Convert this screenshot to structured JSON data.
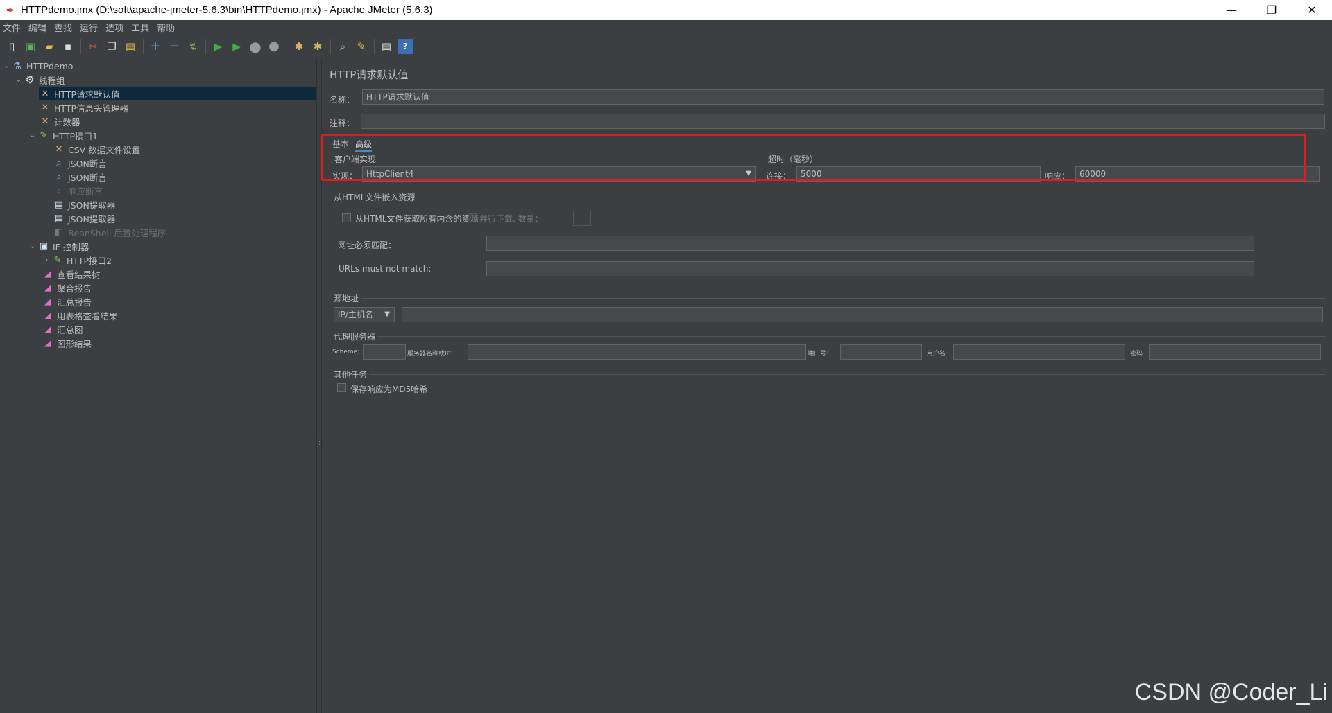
{
  "window": {
    "title": "HTTPdemo.jmx (D:\\soft\\apache-jmeter-5.6.3\\bin\\HTTPdemo.jmx) - Apache JMeter (5.6.3)",
    "minimize": "—",
    "maximize": "❐",
    "close": "✕"
  },
  "menu": [
    "文件",
    "编辑",
    "查找",
    "运行",
    "选项",
    "工具",
    "帮助"
  ],
  "toolbar": {
    "icons": [
      "new-icon",
      "templates-icon",
      "open-icon",
      "save-icon",
      "cut-icon",
      "copy-icon",
      "paste-icon",
      "expand-icon",
      "collapse-icon",
      "toggle-icon",
      "start-icon",
      "start-no-pause-icon",
      "stop-icon",
      "shutdown-icon",
      "clear-icon",
      "clear-all-icon",
      "search-icon",
      "reset-search-icon",
      "function-helper-icon",
      "help-icon"
    ]
  },
  "tree": {
    "items": [
      {
        "label": "HTTPdemo",
        "icon": "test-plan-icon",
        "level": 0,
        "expanded": true
      },
      {
        "label": "线程组",
        "icon": "gear-icon",
        "level": 1,
        "expanded": true
      },
      {
        "label": "HTTP请求默认值",
        "icon": "config-icon",
        "level": 2,
        "selected": true
      },
      {
        "label": "HTTP信息头管理器",
        "icon": "config-icon",
        "level": 2
      },
      {
        "label": "计数器",
        "icon": "config-icon",
        "level": 2
      },
      {
        "label": "HTTP接口1",
        "icon": "sampler-icon",
        "level": 2,
        "expanded": true
      },
      {
        "label": "CSV 数据文件设置",
        "icon": "config-icon",
        "level": 3
      },
      {
        "label": "JSON断言",
        "icon": "assertion-icon",
        "level": 3
      },
      {
        "label": "JSON断言",
        "icon": "assertion-icon",
        "level": 3
      },
      {
        "label": "响应断言",
        "icon": "assertion-icon",
        "level": 3,
        "disabled": true
      },
      {
        "label": "JSON提取器",
        "icon": "extractor-icon",
        "level": 3
      },
      {
        "label": "JSON提取器",
        "icon": "extractor-icon",
        "level": 3
      },
      {
        "label": "BeanShell 后置处理程序",
        "icon": "postprocessor-icon",
        "level": 3,
        "disabled": true
      },
      {
        "label": "IF 控制器",
        "icon": "controller-icon",
        "level": 2,
        "expanded": true
      },
      {
        "label": "HTTP接口2",
        "icon": "sampler-icon",
        "level": 3,
        "collapsed": true
      },
      {
        "label": "查看结果树",
        "icon": "listener-icon",
        "level": 2
      },
      {
        "label": "聚合报告",
        "icon": "listener-icon",
        "level": 2
      },
      {
        "label": "汇总报告",
        "icon": "listener-icon",
        "level": 2
      },
      {
        "label": "用表格查看结果",
        "icon": "listener-icon",
        "level": 2
      },
      {
        "label": "汇总图",
        "icon": "listener-icon",
        "level": 2
      },
      {
        "label": "图形结果",
        "icon": "listener-icon",
        "level": 2
      }
    ]
  },
  "panel": {
    "heading": "HTTP请求默认值",
    "name_label": "名称：",
    "name_value": "HTTP请求默认值",
    "comment_label": "注释：",
    "comment_value": "",
    "tabs": {
      "basic": "基本",
      "advanced": "高级"
    },
    "client": {
      "section": "客户端实现",
      "impl_label": "实现：",
      "impl_value": "HttpClient4"
    },
    "timeout": {
      "section": "超时（毫秒）",
      "connect_label": "连接：",
      "connect_value": "5000",
      "response_label": "响应：",
      "response_value": "60000"
    },
    "embedded": {
      "section": "从HTML文件嵌入资源",
      "retrieve_all": "从HTML文件获取所有内含的资源",
      "parallel": "并行下载. 数量：",
      "must_match": "网址必须匹配：",
      "must_not_match": "URLs must not match:"
    },
    "source": {
      "section": "源地址",
      "type_value": "IP/主机名"
    },
    "proxy": {
      "section": "代理服务器",
      "scheme": "Scheme:",
      "server": "服务器名称或IP：",
      "port": "端口号：",
      "user": "用户名",
      "password": "密码"
    },
    "other": {
      "section": "其他任务",
      "md5": "保存响应为MD5哈希"
    }
  },
  "watermark": "CSDN @Coder_Li",
  "colors": {
    "background": "#3c3f41",
    "field": "#45494a",
    "selection": "#0d293e",
    "highlight": "#e21b1b",
    "tab_underline": "#4a88c7"
  }
}
